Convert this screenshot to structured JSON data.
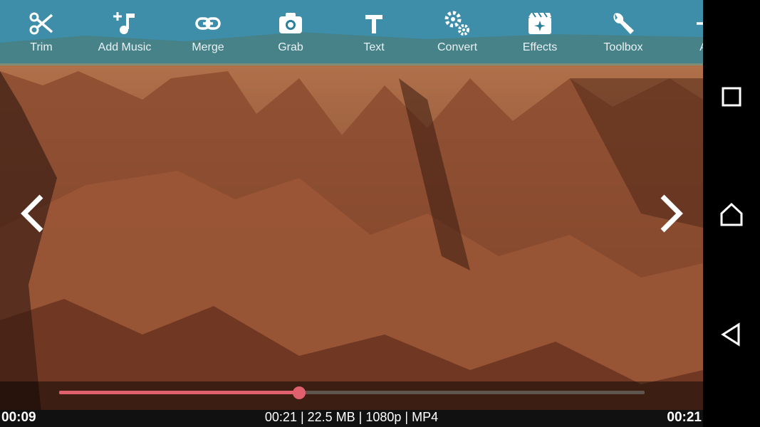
{
  "toolbar": {
    "items": [
      {
        "label": "Trim",
        "icon": "scissors-icon"
      },
      {
        "label": "Add Music",
        "icon": "add-music-icon"
      },
      {
        "label": "Merge",
        "icon": "link-icon"
      },
      {
        "label": "Grab",
        "icon": "camera-icon"
      },
      {
        "label": "Text",
        "icon": "text-icon"
      },
      {
        "label": "Convert",
        "icon": "gears-icon"
      },
      {
        "label": "Effects",
        "icon": "effects-icon"
      },
      {
        "label": "Toolbox",
        "icon": "wrench-icon"
      },
      {
        "label": "Au",
        "icon": "audio-icon"
      }
    ]
  },
  "player": {
    "current_time": "00:09",
    "total_time": "00:21",
    "progress": 0.41,
    "file_info": "00:21 | 22.5 MB | 1080p | MP4"
  },
  "colors": {
    "accent": "#e0606e",
    "toolbar_tint": "#1a7896"
  },
  "system_nav": [
    "recents-icon",
    "home-icon",
    "back-icon"
  ]
}
